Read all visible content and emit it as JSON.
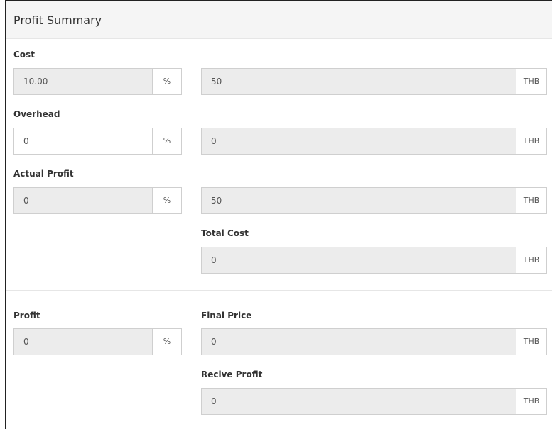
{
  "panel": {
    "title": "Profit Summary"
  },
  "cost": {
    "label": "Cost",
    "percent_value": "10.00",
    "percent_unit": "%",
    "amount_value": "50",
    "amount_unit": "THB"
  },
  "overhead": {
    "label": "Overhead",
    "percent_value": "0",
    "percent_unit": "%",
    "amount_value": "0",
    "amount_unit": "THB"
  },
  "actual_profit": {
    "label": "Actual Profit",
    "percent_value": "0",
    "percent_unit": "%",
    "amount_value": "50",
    "amount_unit": "THB"
  },
  "total_cost": {
    "label": "Total Cost",
    "amount_value": "0",
    "amount_unit": "THB"
  },
  "profit": {
    "label": "Profit",
    "percent_value": "0",
    "percent_unit": "%"
  },
  "final_price": {
    "label": "Final Price",
    "amount_value": "0",
    "amount_unit": "THB"
  },
  "recive_profit": {
    "label": "Recive Profit",
    "amount_value": "0",
    "amount_unit": "THB"
  }
}
